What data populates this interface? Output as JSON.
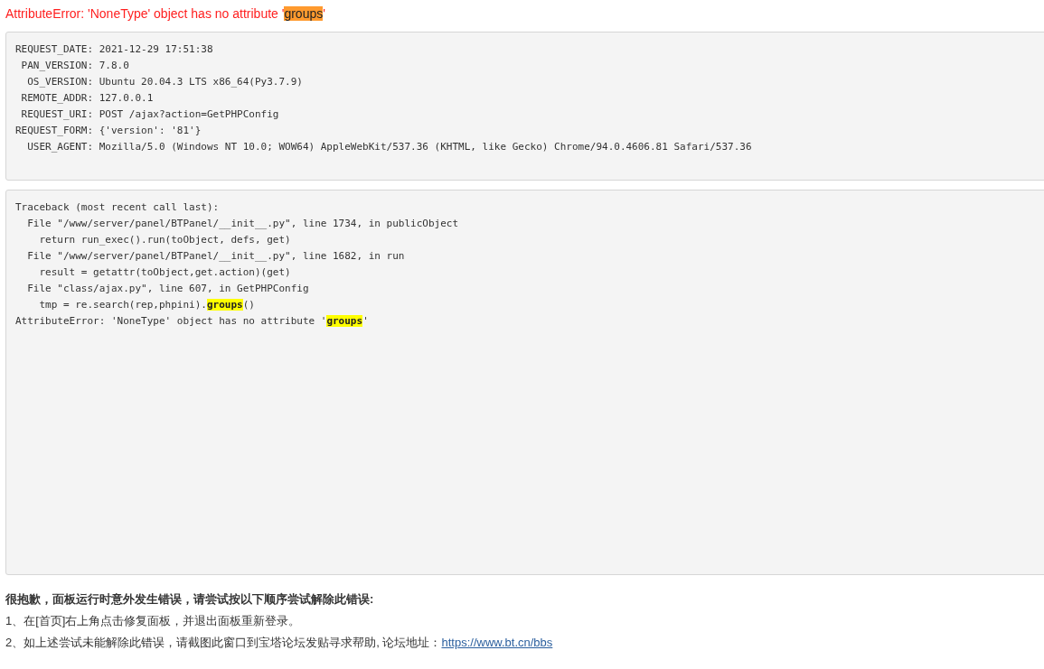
{
  "error_title": [
    {
      "text": "AttributeError: 'NoneType' object has no attribute '",
      "highlight": false
    },
    {
      "text": "groups",
      "highlight": true
    },
    {
      "text": "'",
      "highlight": false
    }
  ],
  "request_info": [
    [
      {
        "text": "REQUEST_DATE: 2021-12-29 17:51:38",
        "highlight": false
      }
    ],
    [
      {
        "text": " PAN_VERSION: 7.8.0",
        "highlight": false
      }
    ],
    [
      {
        "text": "  OS_VERSION: Ubuntu 20.04.3 LTS x86_64(Py3.7.9)",
        "highlight": false
      }
    ],
    [
      {
        "text": " REMOTE_ADDR: 127.0.0.1",
        "highlight": false
      }
    ],
    [
      {
        "text": " REQUEST_URI: POST /ajax?action=GetPHPConfig",
        "highlight": false
      }
    ],
    [
      {
        "text": "REQUEST_FORM: {'version': '81'}",
        "highlight": false
      }
    ],
    [
      {
        "text": "  USER_AGENT: Mozilla/5.0 (Windows NT 10.0; WOW64) AppleWebKit/537.36 (KHTML, like Gecko) Chrome/94.0.4606.81 Safari/537.36",
        "highlight": false
      }
    ]
  ],
  "traceback": [
    [
      {
        "text": "Traceback (most recent call last):",
        "highlight": false
      }
    ],
    [
      {
        "text": "  File \"/www/server/panel/BTPanel/__init__.py\", line 1734, in publicObject",
        "highlight": false
      }
    ],
    [
      {
        "text": "    return run_exec().run(toObject, defs, get)",
        "highlight": false
      }
    ],
    [
      {
        "text": "  File \"/www/server/panel/BTPanel/__init__.py\", line 1682, in run",
        "highlight": false
      }
    ],
    [
      {
        "text": "    result = getattr(toObject,get.action)(get)",
        "highlight": false
      }
    ],
    [
      {
        "text": "  File \"class/ajax.py\", line 607, in GetPHPConfig",
        "highlight": false
      }
    ],
    [
      {
        "text": "    tmp = re.search(rep,phpini).",
        "highlight": false
      },
      {
        "text": "groups",
        "highlight": true
      },
      {
        "text": "()",
        "highlight": false
      }
    ],
    [
      {
        "text": "AttributeError: 'NoneType' object has no attribute '",
        "highlight": false
      },
      {
        "text": "groups",
        "highlight": true
      },
      {
        "text": "'",
        "highlight": false
      }
    ]
  ],
  "help": {
    "heading": "很抱歉，面板运行时意外发生错误，请尝试按以下顺序尝试解除此错误:",
    "steps": [
      {
        "text": "1、在[首页]右上角点击修复面板，并退出面板重新登录。"
      },
      {
        "text": "2、如上述尝试未能解除此错误，请截图此窗口到宝塔论坛发贴寻求帮助, 论坛地址：",
        "link": "https://www.bt.cn/bbs"
      }
    ]
  }
}
